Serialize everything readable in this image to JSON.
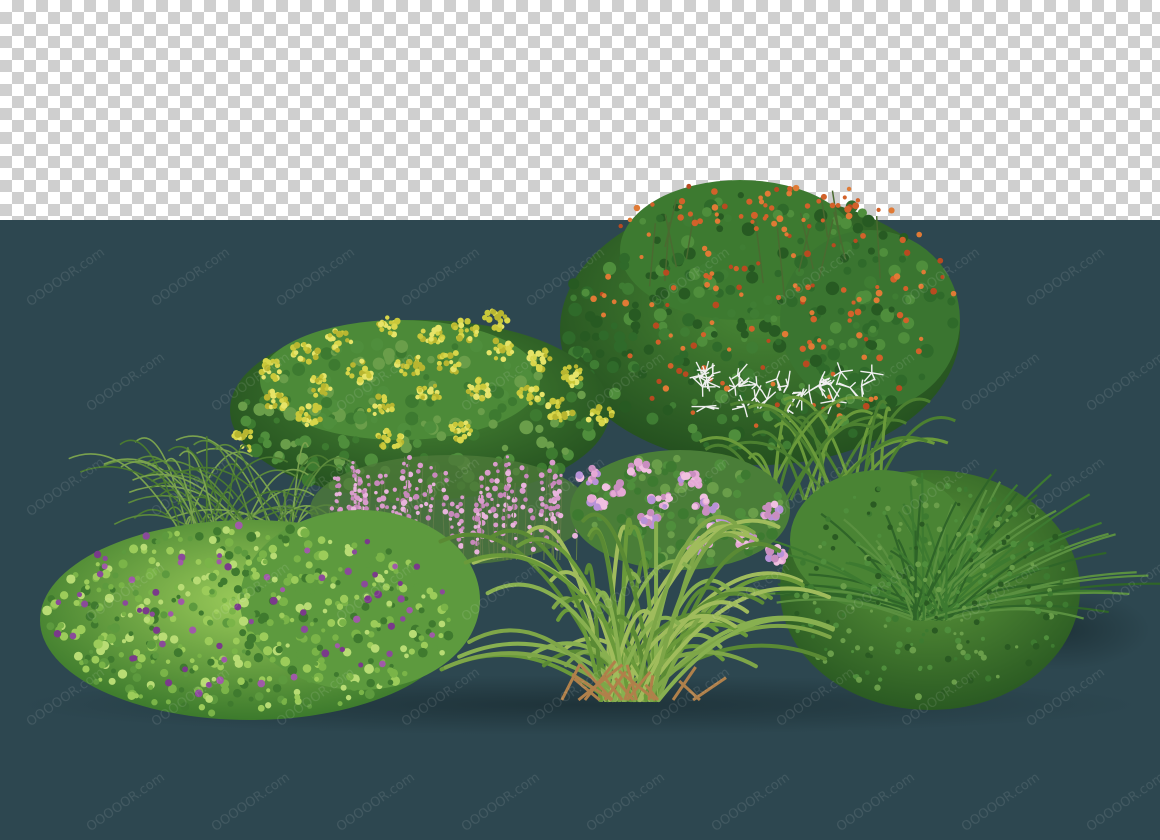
{
  "image": {
    "description_visible": false,
    "watermark_text": "OOOOOR.com",
    "colors": {
      "background": "#2d4750",
      "checker_light": "#ffffff",
      "checker_dark": "#cfcfcf",
      "yellow_flowers": "#d8d64a",
      "pink_flowers": "#d99ccc",
      "purple_flowers": "#8a4a9a",
      "orange_berries": "#d2612a",
      "white_flowers": "#f0f0f0",
      "foliage_dark": "#2f6a2a",
      "foliage_mid": "#4d8a3a",
      "foliage_light": "#8fbf55"
    }
  }
}
